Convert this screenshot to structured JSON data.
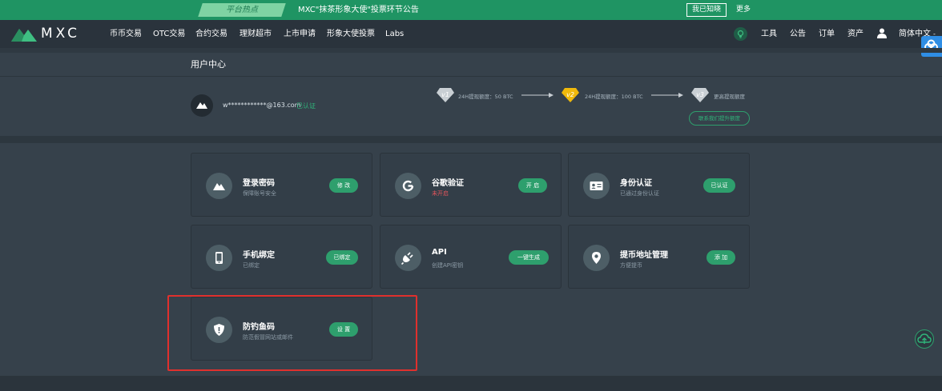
{
  "announcement": {
    "tag": "平台热点",
    "text": "MXC\"抹茶形象大使\"投票环节公告",
    "ack_button": "我已知晓",
    "more": "更多"
  },
  "nav": {
    "logo": "MXC",
    "items": [
      "币币交易",
      "OTC交易",
      "合约交易",
      "理财超市",
      "上市申请",
      "形象大使投票",
      "Labs"
    ],
    "right_items": [
      "工具",
      "公告",
      "订单",
      "资产"
    ],
    "language": "简体中文"
  },
  "page": {
    "title": "用户中心"
  },
  "user": {
    "email": "w************@163.com",
    "status": "已认证"
  },
  "levels": [
    {
      "badge": "v1",
      "limit": "24H提现额度：50 BTC"
    },
    {
      "badge": "v2",
      "limit": "24H提现额度：100 BTC"
    },
    {
      "badge": "v3",
      "limit": "更高提现额度"
    }
  ],
  "contact_button": "联系我们提升额度",
  "cards": [
    {
      "title": "登录密码",
      "subtitle": "保障账号安全",
      "button": "修 改",
      "icon": "mountain-logo-icon"
    },
    {
      "title": "谷歌验证",
      "subtitle": "未开启",
      "button": "开 启",
      "icon": "google-icon"
    },
    {
      "title": "身份认证",
      "subtitle": "已通过身份认证",
      "button": "已认证",
      "icon": "id-card-icon"
    },
    {
      "title": "手机绑定",
      "subtitle": "已绑定",
      "button": "已绑定",
      "icon": "phone-icon"
    },
    {
      "title": "API",
      "subtitle": "创建API密钥",
      "button": "一键生成",
      "icon": "plug-icon"
    },
    {
      "title": "提币地址管理",
      "subtitle": "方便提币",
      "button": "添 加",
      "icon": "location-pin-icon"
    },
    {
      "title": "防钓鱼码",
      "subtitle": "防范假冒网站或邮件",
      "button": "设 置",
      "icon": "shield-icon"
    }
  ],
  "colors": {
    "accent": "#2e9f6d",
    "background": "#36414b",
    "warning": "#e5555b",
    "annotation": "#e0302d"
  }
}
